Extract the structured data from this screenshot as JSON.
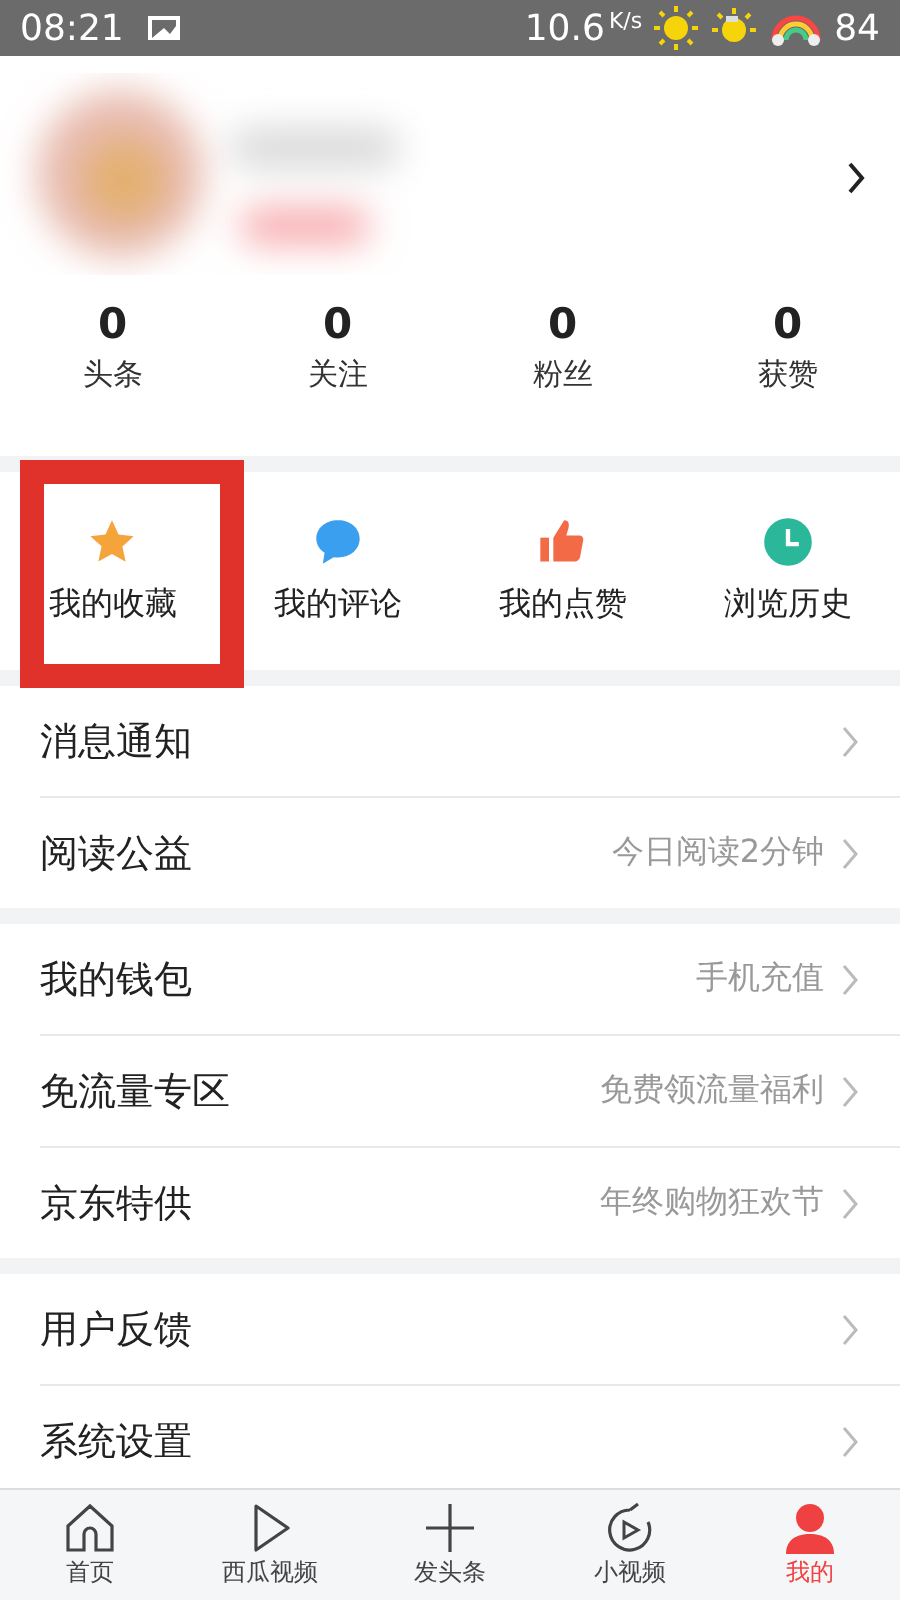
{
  "status_bar": {
    "time": "08:21",
    "speed": "10.6",
    "speed_unit": "K/s",
    "battery": "84"
  },
  "stats": [
    {
      "value": "0",
      "label": "头条"
    },
    {
      "value": "0",
      "label": "关注"
    },
    {
      "value": "0",
      "label": "粉丝"
    },
    {
      "value": "0",
      "label": "获赞"
    }
  ],
  "shortcuts": [
    {
      "kind": "star",
      "label": "我的收藏",
      "highlighted": true
    },
    {
      "kind": "comment",
      "label": "我的评论",
      "highlighted": false
    },
    {
      "kind": "like",
      "label": "我的点赞",
      "highlighted": false
    },
    {
      "kind": "history",
      "label": "浏览历史",
      "highlighted": false
    }
  ],
  "menu_groups": [
    [
      {
        "label": "消息通知"
      },
      {
        "label": "阅读公益",
        "detail": "今日阅读2分钟"
      }
    ],
    [
      {
        "label": "我的钱包",
        "detail": "手机充值"
      },
      {
        "label": "免流量专区",
        "detail": "免费领流量福利"
      },
      {
        "label": "京东特供",
        "detail": "年终购物狂欢节"
      }
    ],
    [
      {
        "label": "用户反馈"
      },
      {
        "label": "系统设置"
      }
    ]
  ],
  "tab_bar": [
    {
      "kind": "home",
      "label": "首页",
      "selected": false
    },
    {
      "kind": "play",
      "label": "西瓜视频",
      "selected": false
    },
    {
      "kind": "plus",
      "label": "发头条",
      "selected": false
    },
    {
      "kind": "short-video",
      "label": "小视频",
      "selected": false
    },
    {
      "kind": "person",
      "label": "我的",
      "selected": true
    }
  ]
}
